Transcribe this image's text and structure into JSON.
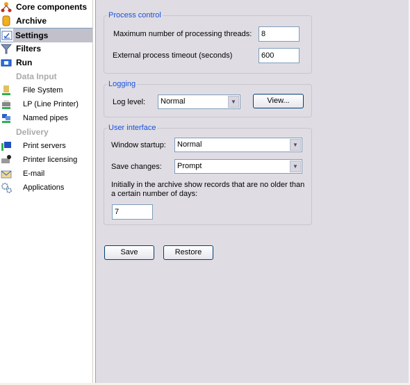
{
  "sidebar": {
    "items": [
      {
        "label": "Core components",
        "icon": "core-components-icon",
        "type": "main"
      },
      {
        "label": "Archive",
        "icon": "archive-icon",
        "type": "main"
      },
      {
        "label": "Settings",
        "icon": "settings-icon",
        "type": "main",
        "selected": true
      },
      {
        "label": "Filters",
        "icon": "filter-icon",
        "type": "main"
      },
      {
        "label": "Run",
        "icon": "run-icon",
        "type": "main"
      },
      {
        "label": "Data Input",
        "type": "group"
      },
      {
        "label": "File System",
        "icon": "file-system-icon",
        "type": "sub"
      },
      {
        "label": "LP (Line Printer)",
        "icon": "printer-icon",
        "type": "sub"
      },
      {
        "label": "Named pipes",
        "icon": "named-pipes-icon",
        "type": "sub"
      },
      {
        "label": "Delivery",
        "type": "group"
      },
      {
        "label": "Print servers",
        "icon": "print-server-icon",
        "type": "sub"
      },
      {
        "label": "Printer licensing",
        "icon": "printer-licensing-icon",
        "type": "sub"
      },
      {
        "label": "E-mail",
        "icon": "email-icon",
        "type": "sub"
      },
      {
        "label": "Applications",
        "icon": "applications-icon",
        "type": "sub"
      }
    ]
  },
  "process": {
    "legend": "Process control",
    "threads_label": "Maximum number of processing threads:",
    "threads_value": "8",
    "timeout_label": "External process timeout (seconds)",
    "timeout_value": "600"
  },
  "logging": {
    "legend": "Logging",
    "level_label": "Log level:",
    "level_value": "Normal",
    "view_label": "View..."
  },
  "ui": {
    "legend": "User interface",
    "startup_label": "Window startup:",
    "startup_value": "Normal",
    "save_changes_label": "Save changes:",
    "save_changes_value": "Prompt",
    "days_label": "Initially in the archive show records that are no older than a certain number of days:",
    "days_value": "7"
  },
  "actions": {
    "save": "Save",
    "restore": "Restore"
  },
  "colors": {
    "accent": "#1850e0",
    "selection": "#c1c0cb",
    "panel": "#dfdde3"
  }
}
